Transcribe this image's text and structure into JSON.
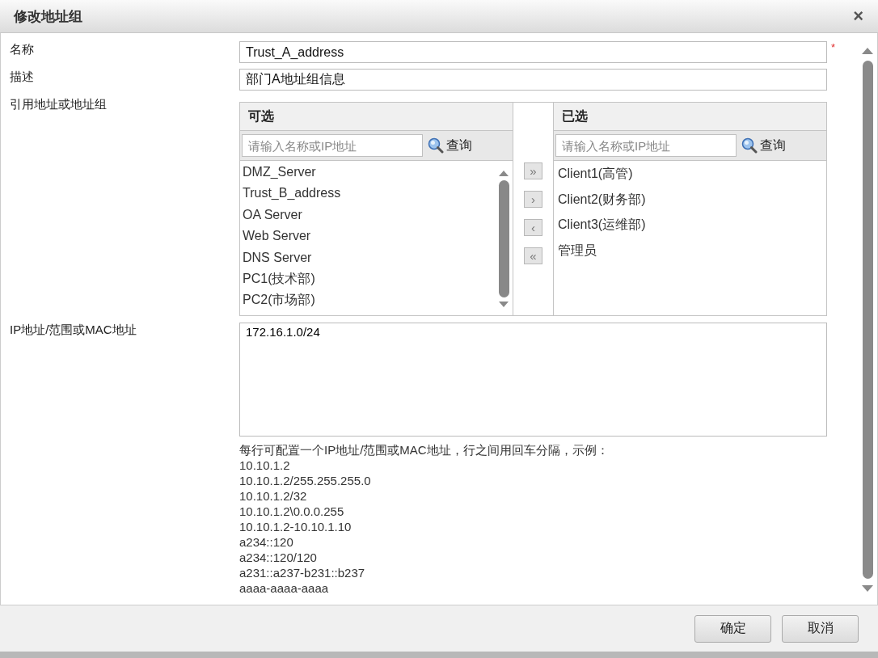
{
  "dialog": {
    "title": "修改地址组",
    "close": "×"
  },
  "name_field": {
    "label": "名称",
    "value": "Trust_A_address",
    "required_mark": "*"
  },
  "description_field": {
    "label": "描述",
    "value": "部门A地址组信息"
  },
  "members": {
    "label": "引用地址或地址组",
    "available": {
      "title": "可选",
      "search_placeholder": "请输入名称或IP地址",
      "search_button": "查询",
      "items": [
        "DMZ_Server",
        "Trust_B_address",
        "OA Server",
        "Web Server",
        "DNS Server",
        "PC1(技术部)",
        "PC2(市场部)"
      ]
    },
    "move_buttons": [
      "»",
      "›",
      "‹",
      "«"
    ],
    "selected": {
      "title": "已选",
      "search_placeholder": "请输入名称或IP地址",
      "search_button": "查询",
      "items": [
        "Client1(高管)",
        "Client2(财务部)",
        "Client3(运维部)",
        "管理员"
      ]
    }
  },
  "ip_field": {
    "label": "IP地址/范围或MAC地址",
    "value": "172.16.1.0/24"
  },
  "hint": {
    "intro": "每行可配置一个IP地址/范围或MAC地址，行之间用回车分隔，示例：",
    "examples": [
      "10.10.1.2",
      "10.10.1.2/255.255.255.0",
      "10.10.1.2/32",
      "10.10.1.2\\0.0.0.255",
      "10.10.1.2-10.10.1.10",
      "a234::120",
      "a234::120/120",
      "a231::a237-b231::b237",
      "aaaa-aaaa-aaaa"
    ]
  },
  "buttons": [
    "确定",
    "取消"
  ]
}
